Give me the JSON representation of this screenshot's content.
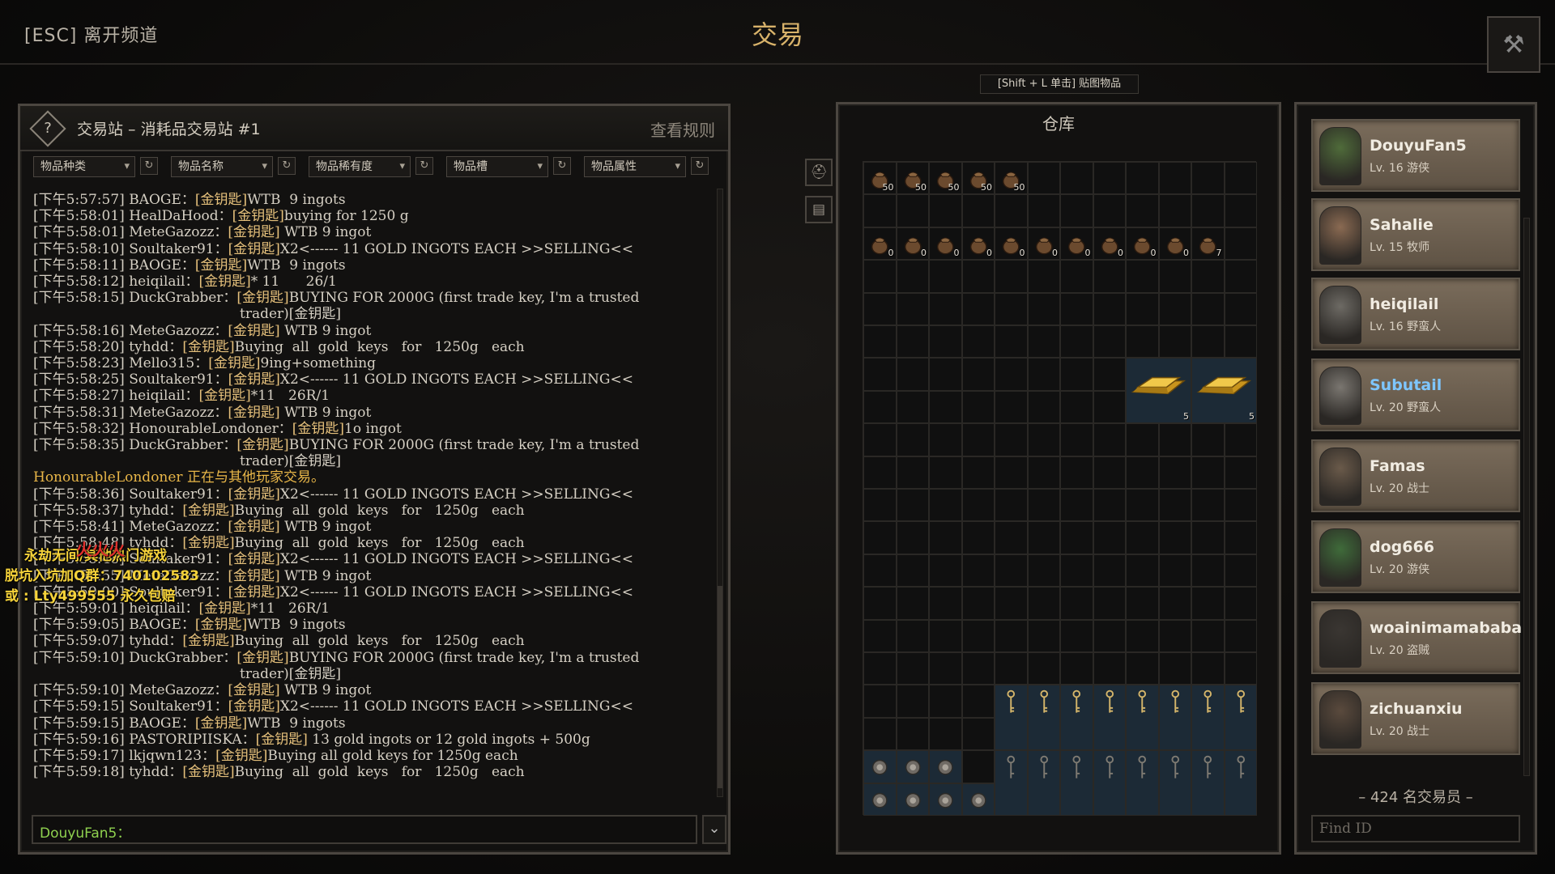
{
  "header": {
    "esc_label": "[ESC] 离开频道",
    "title": "交易",
    "hint": "[Shift + L 单击] 贴图物品"
  },
  "chat_panel": {
    "title": "交易站 – 消耗品交易站 #1",
    "rules_label": "查看规则",
    "filters": [
      "物品种类",
      "物品名称",
      "物品稀有度",
      "物品槽",
      "物品属性"
    ],
    "input_name": "DouyuFan5：",
    "send_icon": "chevron-down-icon",
    "messages": [
      {
        "t": "[下午5:57:57]",
        "n": "BAOGE",
        "k": "[金钥匙]",
        "m": "WTB  9 ingots"
      },
      {
        "t": "[下午5:58:01]",
        "n": "HealDaHood",
        "k": "[金钥匙]",
        "m": "buying for 1250 g"
      },
      {
        "t": "[下午5:58:01]",
        "n": "MeteGazozz",
        "k": "[金钥匙]",
        "m": " WTB 9 ingot"
      },
      {
        "t": "[下午5:58:10]",
        "n": "Soultaker91",
        "k": "[金钥匙]",
        "m": "X2<------ 11 GOLD INGOTS EACH >>SELLING<<"
      },
      {
        "t": "[下午5:58:11]",
        "n": "BAOGE",
        "k": "[金钥匙]",
        "m": "WTB  9 ingots"
      },
      {
        "t": "[下午5:58:12]",
        "n": "heiqilail",
        "k": "[金钥匙]",
        "m": "* 11      26/1"
      },
      {
        "t": "[下午5:58:15]",
        "n": "DuckGrabber",
        "k": "[金钥匙]",
        "m": "BUYING FOR 2000G (first trade key, I'm a trusted"
      },
      {
        "cont": "trader)[金钥匙]"
      },
      {
        "t": "[下午5:58:16]",
        "n": "MeteGazozz",
        "k": "[金钥匙]",
        "m": " WTB 9 ingot"
      },
      {
        "t": "[下午5:58:20]",
        "n": "tyhdd",
        "k": "[金钥匙]",
        "m": "Buying  all  gold  keys   for   1250g   each"
      },
      {
        "t": "[下午5:58:23]",
        "n": "Mello315",
        "k": "[金钥匙]",
        "m": "9ing+something"
      },
      {
        "t": "[下午5:58:25]",
        "n": "Soultaker91",
        "k": "[金钥匙]",
        "m": "X2<------ 11 GOLD INGOTS EACH >>SELLING<<"
      },
      {
        "t": "[下午5:58:27]",
        "n": "heiqilail",
        "k": "[金钥匙]",
        "m": "*11   26R/1"
      },
      {
        "t": "[下午5:58:31]",
        "n": "MeteGazozz",
        "k": "[金钥匙]",
        "m": " WTB 9 ingot"
      },
      {
        "t": "[下午5:58:32]",
        "n": "HonourableLondoner",
        "k": "[金钥匙]",
        "m": "1o ingot"
      },
      {
        "t": "[下午5:58:35]",
        "n": "DuckGrabber",
        "k": "[金钥匙]",
        "m": "BUYING FOR 2000G (first trade key, I'm a trusted"
      },
      {
        "cont": "trader)[金钥匙]"
      },
      {
        "sys": "HonourableLondoner 正在与其他玩家交易。"
      },
      {
        "t": "[下午5:58:36]",
        "n": "Soultaker91",
        "k": "[金钥匙]",
        "m": "X2<------ 11 GOLD INGOTS EACH >>SELLING<<"
      },
      {
        "t": "[下午5:58:37]",
        "n": "tyhdd",
        "k": "[金钥匙]",
        "m": "Buying  all  gold  keys   for   1250g   each"
      },
      {
        "t": "[下午5:58:41]",
        "n": "MeteGazozz",
        "k": "[金钥匙]",
        "m": " WTB 9 ingot"
      },
      {
        "t": "[下午5:58:48]",
        "n": "tyhdd",
        "k": "[金钥匙]",
        "m": "Buying  all  gold  keys   for   1250g   each"
      },
      {
        "t": "[下午5:58:48]",
        "n": "Soultaker91",
        "k": "[金钥匙]",
        "m": "X2<------ 11 GOLD INGOTS EACH >>SELLING<<"
      },
      {
        "t": "[下午5:58:55]",
        "n": "MeteGazozz",
        "k": "[金钥匙]",
        "m": " WTB 9 ingot"
      },
      {
        "t": "[下午5:59:00]",
        "n": "Soultaker91",
        "k": "[金钥匙]",
        "m": "X2<------ 11 GOLD INGOTS EACH >>SELLING<<"
      },
      {
        "t": "[下午5:59:01]",
        "n": "heiqilail",
        "k": "[金钥匙]",
        "m": "*11   26R/1"
      },
      {
        "t": "[下午5:59:05]",
        "n": "BAOGE",
        "k": "[金钥匙]",
        "m": "WTB  9 ingots"
      },
      {
        "t": "[下午5:59:07]",
        "n": "tyhdd",
        "k": "[金钥匙]",
        "m": "Buying  all  gold  keys   for   1250g   each"
      },
      {
        "t": "[下午5:59:10]",
        "n": "DuckGrabber",
        "k": "[金钥匙]",
        "m": "BUYING FOR 2000G (first trade key, I'm a trusted"
      },
      {
        "cont": "trader)[金钥匙]"
      },
      {
        "t": "[下午5:59:10]",
        "n": "MeteGazozz",
        "k": "[金钥匙]",
        "m": " WTB 9 ingot"
      },
      {
        "t": "[下午5:59:15]",
        "n": "Soultaker91",
        "k": "[金钥匙]",
        "m": "X2<------ 11 GOLD INGOTS EACH >>SELLING<<"
      },
      {
        "t": "[下午5:59:15]",
        "n": "BAOGE",
        "k": "[金钥匙]",
        "m": "WTB  9 ingots"
      },
      {
        "t": "[下午5:59:16]",
        "n": "PASTORIPIISKA",
        "k": "[金钥匙]",
        "m": " 13 gold ingots or 12 gold ingots + 500g"
      },
      {
        "t": "[下午5:59:17]",
        "n": "lkjqwn123",
        "k": "[金钥匙]",
        "m": "Buying all gold keys for 1250g each"
      },
      {
        "t": "[下午5:59:18]",
        "n": "tyhdd",
        "k": "[金钥匙]",
        "m": "Buying  all  gold  keys   for   1250g   each"
      }
    ]
  },
  "watermark": {
    "line_red": "火火火",
    "line1": "永劫无间/其他热门游戏",
    "line2": "脱坑入坑加Q群：740102583",
    "line3": "或  : Lty499555  永久包赔"
  },
  "storage": {
    "title": "仓库",
    "pouch_row1_qty": [
      "50",
      "50",
      "50",
      "50",
      "50"
    ],
    "pouch_row3_qty": [
      "0",
      "0",
      "0",
      "0",
      "0",
      "0",
      "0",
      "0",
      "0",
      "0",
      "7"
    ],
    "ingot_qty": [
      "5",
      "5"
    ]
  },
  "members": {
    "list": [
      {
        "name": "DouyuFan5",
        "level": "Lv. 16 游侠"
      },
      {
        "name": "Sahalie",
        "level": "Lv. 15 牧师"
      },
      {
        "name": "heiqilail",
        "level": "Lv. 16 野蛮人"
      },
      {
        "name": "Subutail",
        "level": "Lv. 20 野蛮人"
      },
      {
        "name": "Famas",
        "level": "Lv. 20 战士"
      },
      {
        "name": "dog666",
        "level": "Lv. 20 游侠"
      },
      {
        "name": "woainimamababa",
        "level": "Lv. 20 盗贼"
      },
      {
        "name": "zichuanxiu",
        "level": "Lv. 20 战士"
      }
    ],
    "count_label": "– 424 名交易员 –",
    "find_placeholder": "Find ID"
  }
}
